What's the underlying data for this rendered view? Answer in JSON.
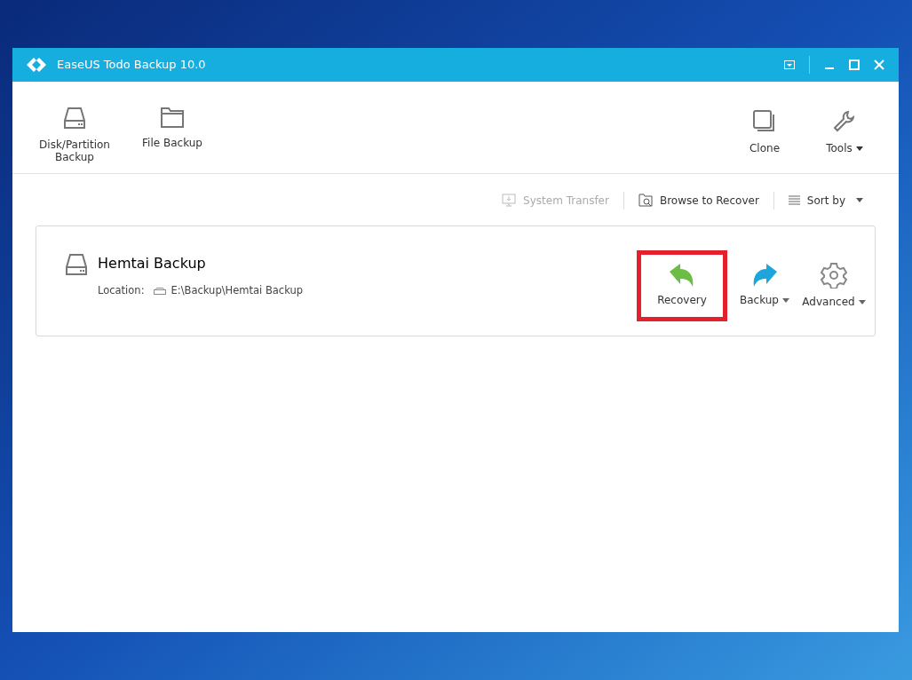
{
  "window": {
    "title": "EaseUS Todo Backup 10.0"
  },
  "toolbar": {
    "left": [
      {
        "label": "Disk/Partition\nBackup",
        "kind": "disk",
        "dropdown": false
      },
      {
        "label": "File Backup",
        "kind": "folder",
        "dropdown": false
      }
    ],
    "right": [
      {
        "label": "Clone",
        "kind": "clone",
        "dropdown": false
      },
      {
        "label": "Tools",
        "kind": "wrench",
        "dropdown": true
      }
    ]
  },
  "actions": [
    {
      "label": "System Transfer",
      "kind": "transfer",
      "disabled": true,
      "dropdown": false
    },
    {
      "label": "Browse to Recover",
      "kind": "browse",
      "disabled": false,
      "dropdown": false
    },
    {
      "label": "Sort by",
      "kind": "sort",
      "disabled": false,
      "dropdown": true
    }
  ],
  "backups": [
    {
      "name": "Hemtai Backup",
      "location_label": "Location:",
      "location": "E:\\Backup\\Hemtai Backup",
      "buttons": [
        {
          "label": "Recovery",
          "kind": "recovery",
          "dropdown": false,
          "highlighted": true
        },
        {
          "label": "Backup",
          "kind": "backup",
          "dropdown": true,
          "highlighted": false
        },
        {
          "label": "Advanced",
          "kind": "gear",
          "dropdown": true,
          "highlighted": false
        }
      ]
    }
  ]
}
